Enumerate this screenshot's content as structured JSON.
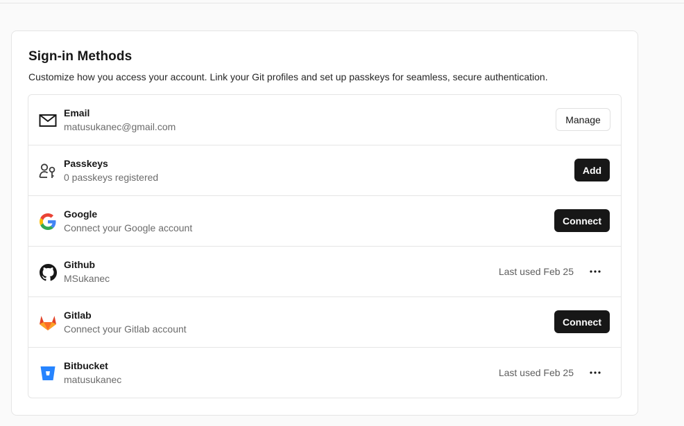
{
  "card": {
    "title": "Sign-in Methods",
    "subtitle": "Customize how you access your account. Link your Git profiles and set up passkeys for seamless, secure authentication."
  },
  "methods": [
    {
      "title": "Email",
      "subtitle": "matusukanec@gmail.com",
      "icon": "mail-icon",
      "action": "Manage"
    },
    {
      "title": "Passkeys",
      "subtitle": "0 passkeys registered",
      "icon": "passkey-icon",
      "action": "Add"
    },
    {
      "title": "Google",
      "subtitle": "Connect your Google account",
      "icon": "google-icon",
      "action": "Connect"
    },
    {
      "title": "Github",
      "subtitle": "MSukanec",
      "icon": "github-icon",
      "last_used": "Last used Feb 25",
      "menu": "more-icon"
    },
    {
      "title": "Gitlab",
      "subtitle": "Connect your Gitlab account",
      "icon": "gitlab-icon",
      "action": "Connect"
    },
    {
      "title": "Bitbucket",
      "subtitle": "matusukanec",
      "icon": "bitbucket-icon",
      "last_used": "Last used Feb 25",
      "menu": "more-icon"
    }
  ],
  "colors": {
    "primary_button": "#171717",
    "google_blue": "#4285F4",
    "google_red": "#EA4335",
    "google_yellow": "#FBBC05",
    "google_green": "#34A853",
    "gitlab_orange": "#FC6D26",
    "bitbucket_blue": "#2684FF"
  }
}
